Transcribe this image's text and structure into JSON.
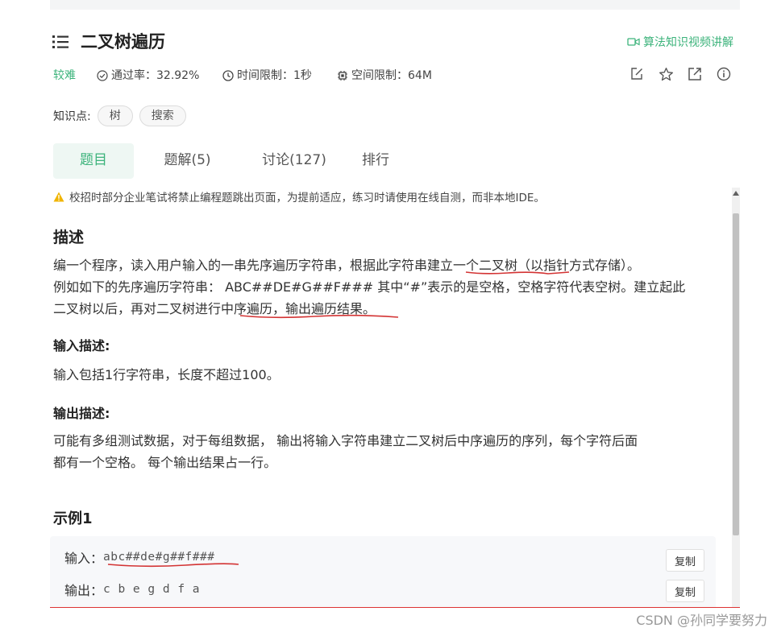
{
  "header": {
    "title": "二叉树遍历",
    "video_link": "算法知识视频讲解"
  },
  "meta": {
    "difficulty": "较难",
    "pass_rate": "通过率：32.92%",
    "time_limit": "时间限制：1秒",
    "memory_limit": "空间限制：64M"
  },
  "knowledge": {
    "label": "知识点:",
    "tags": [
      "树",
      "搜索"
    ]
  },
  "tabs": [
    {
      "label": "题目",
      "active": true
    },
    {
      "label": "题解(5)"
    },
    {
      "label": "讨论(127)"
    },
    {
      "label": "排行"
    }
  ],
  "notice": "校招时部分企业笔试将禁止编程题跳出页面，为提前适应，练习时请使用在线自测，而非本地IDE。",
  "description": {
    "heading": "描述",
    "line1": "编一个程序，读入用户输入的一串先序遍历字符串，根据此字符串建立一个二叉树（以指针方式存储）。",
    "line2": "例如如下的先序遍历字符串： ABC##DE#G##F### 其中“#”表示的是空格，空格字符代表空树。建立起此",
    "line3": "二叉树以后，再对二叉树进行中序遍历，输出遍历结果。"
  },
  "input_desc": {
    "heading": "输入描述:",
    "text": "输入包括1行字符串，长度不超过100。"
  },
  "output_desc": {
    "heading": "输出描述:",
    "line1": "可能有多组测试数据，对于每组数据， 输出将输入字符串建立二叉树后中序遍历的序列，每个字符后面",
    "line2": "都有一个空格。 每个输出结果占一行。"
  },
  "example": {
    "heading": "示例1",
    "input_label": "输入：",
    "input_value": "abc##de#g##f###",
    "output_label": "输出：",
    "output_value": "c b e g d f a",
    "copy_label": "复制"
  },
  "watermark": "CSDN @孙同学要努力",
  "colors": {
    "accent": "#3cb37b",
    "warning": "#f0b400",
    "annotation": "#d33333"
  }
}
